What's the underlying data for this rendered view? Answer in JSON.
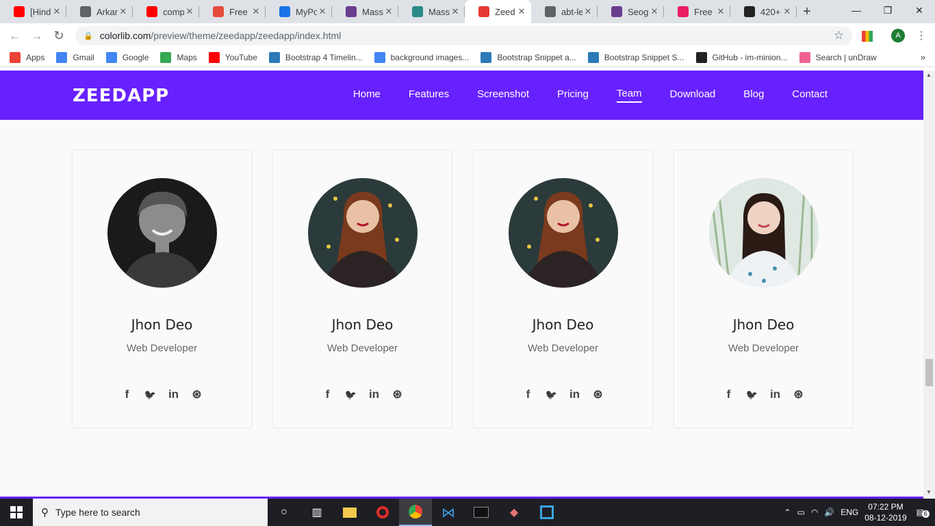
{
  "browser": {
    "tabs": [
      {
        "title": "[Hindi]",
        "icon": "youtube-icon",
        "color": "#ff0000"
      },
      {
        "title": "Arkan",
        "icon": "globe-icon",
        "color": "#5f6368"
      },
      {
        "title": "comp",
        "icon": "youtube-icon",
        "color": "#ff0000"
      },
      {
        "title": "Free E",
        "icon": "s-icon",
        "color": "#e44c3c"
      },
      {
        "title": "MyPo",
        "icon": "flutter-icon",
        "color": "#1a73e8"
      },
      {
        "title": "Massi",
        "icon": "colorlib-icon",
        "color": "#6a3d8f"
      },
      {
        "title": "Massi",
        "icon": "site-icon",
        "color": "#2b8a8a"
      },
      {
        "title": "Zeed",
        "icon": "zeedapp-icon",
        "color": "#e53935"
      },
      {
        "title": "abt-le",
        "icon": "wordpress-icon",
        "color": "#5f6368"
      },
      {
        "title": "Seog",
        "icon": "colorlib-icon",
        "color": "#6a3d8f"
      },
      {
        "title": "Free E",
        "icon": "page-icon",
        "color": "#e91e63"
      },
      {
        "title": "420+",
        "icon": "horse-icon",
        "color": "#222222"
      }
    ],
    "active_tab_index": 7,
    "url_host": "colorlib.com",
    "url_path": "/preview/theme/zeedapp/zeedapp/index.html",
    "profile_initial": "A",
    "bookmarks": [
      {
        "label": "Apps",
        "icon": "apps-grid-icon",
        "color": "#ea4335"
      },
      {
        "label": "Gmail",
        "icon": "google-icon",
        "color": "#4285f4"
      },
      {
        "label": "Google",
        "icon": "google-icon",
        "color": "#4285f4"
      },
      {
        "label": "Maps",
        "icon": "maps-icon",
        "color": "#34a853"
      },
      {
        "label": "YouTube",
        "icon": "youtube-icon",
        "color": "#ff0000"
      },
      {
        "label": "Bootstrap 4 Timelin...",
        "icon": "bootstrap-snippet-icon",
        "color": "#2a7ab8"
      },
      {
        "label": "background images...",
        "icon": "google-icon",
        "color": "#4285f4"
      },
      {
        "label": "Bootstrap Snippet a...",
        "icon": "bootstrap-snippet-icon",
        "color": "#2a7ab8"
      },
      {
        "label": "Bootstrap Snippet S...",
        "icon": "bootstrap-snippet-icon",
        "color": "#2a7ab8"
      },
      {
        "label": "GitHub - im-minion...",
        "icon": "github-icon",
        "color": "#222222"
      },
      {
        "label": "Search | unDraw",
        "icon": "undraw-icon",
        "color": "#f06292"
      }
    ]
  },
  "site": {
    "logo": "ZEEDAPP",
    "accent": "#6721ff",
    "nav": [
      "Home",
      "Features",
      "Screenshot",
      "Pricing",
      "Team",
      "Download",
      "Blog",
      "Contact"
    ],
    "active_nav": "Team",
    "team": [
      {
        "name": "Jhon Deo",
        "role": "Web Developer",
        "photo": "man-portrait"
      },
      {
        "name": "Jhon Deo",
        "role": "Web Developer",
        "photo": "woman-red-hair-portrait"
      },
      {
        "name": "Jhon Deo",
        "role": "Web Developer",
        "photo": "woman-red-hair-portrait"
      },
      {
        "name": "Jhon Deo",
        "role": "Web Developer",
        "photo": "woman-floral-portrait"
      }
    ],
    "social_icons": [
      "facebook-icon",
      "twitter-icon",
      "linkedin-icon",
      "dribbble-icon"
    ]
  },
  "taskbar": {
    "search_placeholder": "Type here to search",
    "language": "ENG",
    "time": "07:22 PM",
    "date": "08-12-2019",
    "notification_count": "6"
  }
}
